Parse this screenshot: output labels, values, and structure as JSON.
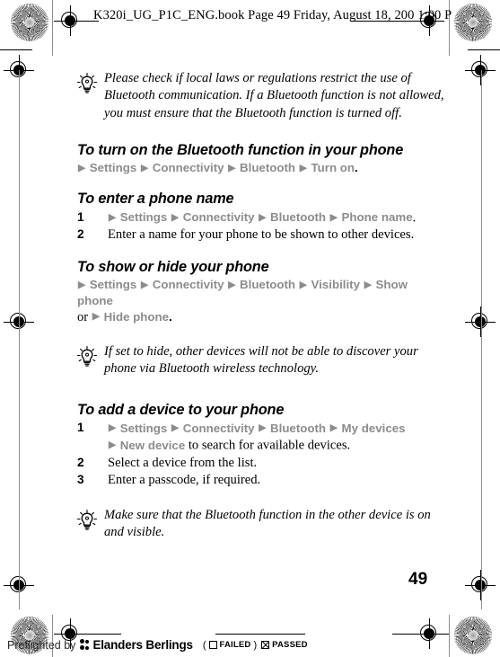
{
  "header": {
    "text": "K320i_UG_P1C_ENG.book  Page 49  Friday, August 18, 200  1:00 P"
  },
  "page_number": "49",
  "colors": {
    "path_gray": "#8c8c8c",
    "text_black": "#000000",
    "page_background": "#ffffff"
  },
  "content": {
    "tip_1": {
      "icon": "lightbulb-icon",
      "text": "Please check if local laws or regulations restrict the use of Bluetooth communication. If a Bluetooth function is not allowed, you must ensure that the Bluetooth function is turned off."
    },
    "section_1": {
      "title": "To turn on the Bluetooth function in your phone",
      "path": {
        "items": [
          "Settings",
          "Connectivity",
          "Bluetooth",
          "Turn on"
        ],
        "separator": "▶",
        "trailing": "."
      }
    },
    "section_2": {
      "title": "To enter a phone name",
      "steps": [
        {
          "number": "1",
          "type": "path",
          "items": [
            "Settings",
            "Connectivity",
            "Bluetooth",
            "Phone name"
          ],
          "trailing": "."
        },
        {
          "number": "2",
          "type": "text",
          "text": "Enter a name for your phone to be shown to other devices."
        }
      ]
    },
    "section_3": {
      "title": "To show or hide your phone",
      "path_line_1": {
        "items": [
          "Settings",
          "Connectivity",
          "Bluetooth",
          "Visibility",
          "Show phone"
        ]
      },
      "path_line_2": {
        "lead_text": "or",
        "items": [
          "Hide phone"
        ],
        "trailing": "."
      }
    },
    "tip_2": {
      "icon": "lightbulb-icon",
      "text": "If set to hide, other devices will not be able to discover your phone via Bluetooth wireless technology."
    },
    "section_4": {
      "title": "To add a device to your phone",
      "steps": [
        {
          "number": "1",
          "type": "path-wrap",
          "items": [
            "Settings",
            "Connectivity",
            "Bluetooth",
            "My devices"
          ],
          "wrap_items": [
            "New device"
          ],
          "wrap_text": " to search for available devices."
        },
        {
          "number": "2",
          "type": "text",
          "text": "Select a device from the list."
        },
        {
          "number": "3",
          "type": "text",
          "text": "Enter a passcode, if required."
        }
      ]
    },
    "tip_3": {
      "icon": "lightbulb-icon",
      "text": "Make sure that the Bluetooth function in the other device is on and visible."
    }
  },
  "footer": {
    "preflighted_by": "Preflighted by",
    "brand": "Elanders Berlings",
    "paren_open": "(",
    "failed_label": "FAILED",
    "paren_close": ")",
    "passed_label": "PASSED"
  }
}
